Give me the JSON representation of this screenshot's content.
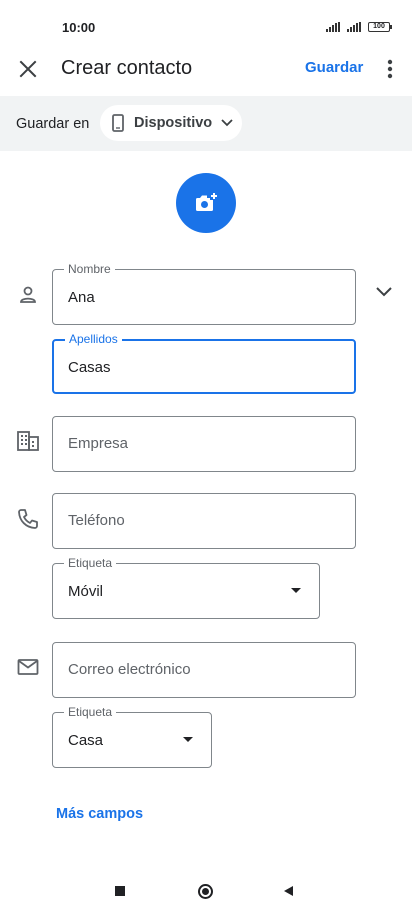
{
  "status_bar": {
    "time": "10:00",
    "battery": "100",
    "icons": [
      "signal-icon",
      "signal-icon",
      "battery-icon"
    ]
  },
  "app_bar": {
    "title": "Crear contacto",
    "save_label": "Guardar",
    "icons": [
      "close-icon",
      "more-vert-icon"
    ]
  },
  "save_in": {
    "label": "Guardar en",
    "account": "Dispositivo",
    "icons": [
      "phone-icon",
      "chevron-down-icon"
    ]
  },
  "photo": {
    "icon": "add-photo-icon"
  },
  "fields": {
    "nombre": {
      "label": "Nombre",
      "value": "Ana",
      "icon": "person-icon"
    },
    "apellidos": {
      "label": "Apellidos",
      "value": "Casas"
    },
    "empresa": {
      "placeholder": "Empresa",
      "icon": "business-icon"
    },
    "telefono": {
      "placeholder": "Teléfono",
      "icon": "phone-call-icon"
    },
    "telefono_etiqueta": {
      "label": "Etiqueta",
      "value": "Móvil"
    },
    "correo": {
      "placeholder": "Correo electrónico",
      "icon": "email-icon"
    },
    "correo_etiqueta": {
      "label": "Etiqueta",
      "value": "Casa"
    }
  },
  "more_fields_label": "Más campos",
  "nav_bar": {
    "icons": [
      "recents-icon",
      "home-icon",
      "back-icon"
    ]
  },
  "colors": {
    "accent": "#1a73e8",
    "header_bg": "#f1f3f4",
    "outline": "#80868b",
    "text": "#202124"
  }
}
